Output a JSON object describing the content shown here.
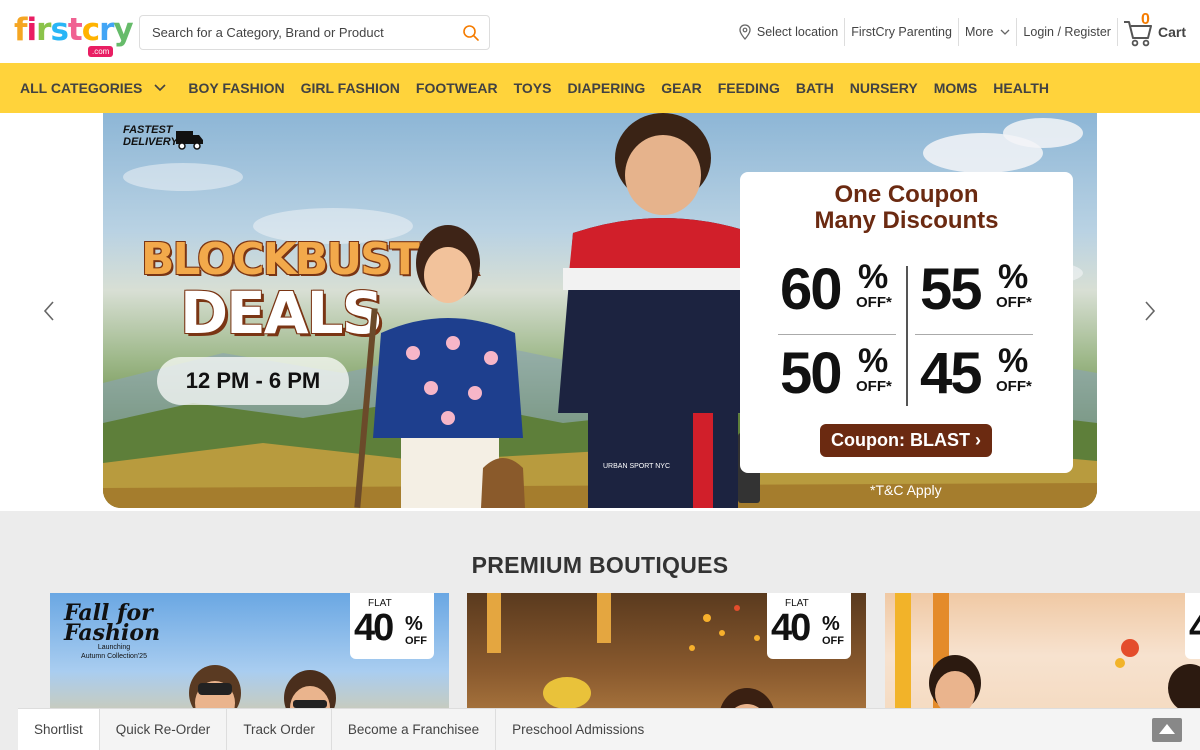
{
  "header": {
    "logo_text": "firstcry",
    "logo_domain": ".com",
    "search_placeholder": "Search for a Category, Brand or Product",
    "select_location": "Select location",
    "parenting": "FirstCry Parenting",
    "more": "More",
    "login": "Login / Register",
    "cart_count": "0",
    "cart_label": "Cart"
  },
  "nav": {
    "all_categories": "ALL CATEGORIES",
    "items": [
      "BOY FASHION",
      "GIRL FASHION",
      "FOOTWEAR",
      "TOYS",
      "DIAPERING",
      "GEAR",
      "FEEDING",
      "BATH",
      "NURSERY",
      "MOMS",
      "HEALTH"
    ]
  },
  "banner": {
    "badge": "FASTEST DELIVERY",
    "title1": "BLOCKBUSTER",
    "title2": "DEALS",
    "time": "12 PM - 6 PM",
    "coupon_title_line1": "One Coupon",
    "coupon_title_line2": "Many Discounts",
    "discounts": [
      {
        "value": "60",
        "pct": "%",
        "off": "OFF*"
      },
      {
        "value": "55",
        "pct": "%",
        "off": "OFF*"
      },
      {
        "value": "50",
        "pct": "%",
        "off": "OFF*"
      },
      {
        "value": "45",
        "pct": "%",
        "off": "OFF*"
      }
    ],
    "coupon_button": "Coupon: BLAST ›",
    "tc": "*T&C Apply",
    "shirt_text": "URBAN SPORT NYC"
  },
  "boutiques": {
    "title": "PREMIUM BOUTIQUES",
    "cards": [
      {
        "flat": "FLAT",
        "value": "40",
        "pct": "%",
        "off": "OFF",
        "logo_line1": "Fall for",
        "logo_line2": "Fashion",
        "logo_sub1": "Launching",
        "logo_sub2": "Autumn Collection'25"
      },
      {
        "flat": "FLAT",
        "value": "40",
        "pct": "%",
        "off": "OFF"
      },
      {
        "flat": "",
        "value": "4",
        "pct": "",
        "off": ""
      }
    ]
  },
  "bottom_bar": {
    "items": [
      "Shortlist",
      "Quick Re-Order",
      "Track Order",
      "Become a Franchisee",
      "Preschool Admissions"
    ]
  },
  "colors": {
    "nav_bg": "#ffd33b",
    "coupon_brown": "#6b2a11",
    "cart_orange": "#f57c00",
    "brand_pink": "#e91e63"
  }
}
